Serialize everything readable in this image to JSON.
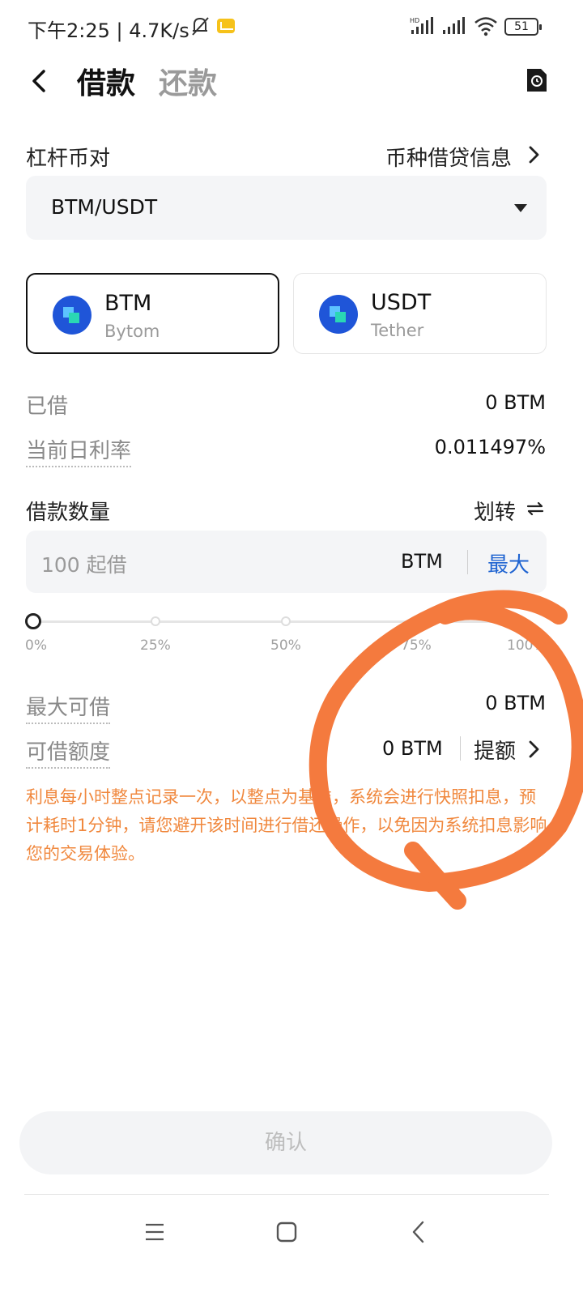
{
  "status_bar": {
    "time_speed": "下午2:25 | 4.7K/s",
    "battery": "51"
  },
  "header": {
    "tab_borrow": "借款",
    "tab_repay": "还款"
  },
  "pair": {
    "label": "杠杆币对",
    "info_link": "币种借贷信息",
    "selected": "BTM/USDT"
  },
  "coins": [
    {
      "symbol": "BTM",
      "name": "Bytom"
    },
    {
      "symbol": "USDT",
      "name": "Tether"
    }
  ],
  "stats": {
    "borrowed_label": "已借",
    "borrowed_value": "0 BTM",
    "rate_label": "当前日利率",
    "rate_value": "0.011497%"
  },
  "amount": {
    "label": "借款数量",
    "transfer": "划转",
    "placeholder": "100  起借",
    "unit": "BTM",
    "max": "最大"
  },
  "slider": {
    "ticks": [
      "0%",
      "25%",
      "50%",
      "75%",
      "100%"
    ],
    "value_percent": 0
  },
  "limits": {
    "max_label": "最大可借",
    "max_value": "0 BTM",
    "quota_label": "可借额度",
    "quota_value": "0 BTM",
    "raise": "提额"
  },
  "notice": "利息每小时整点记录一次，以整点为基准，系统会进行快照扣息，预计耗时1分钟，请您避开该时间进行借还操作，以免因为系统扣息影响您的交易体验。",
  "confirm_label": "确认",
  "colors": {
    "accent_blue": "#1e63d1",
    "notice_orange": "#f0883e",
    "scribble_orange": "#f47a3e"
  }
}
